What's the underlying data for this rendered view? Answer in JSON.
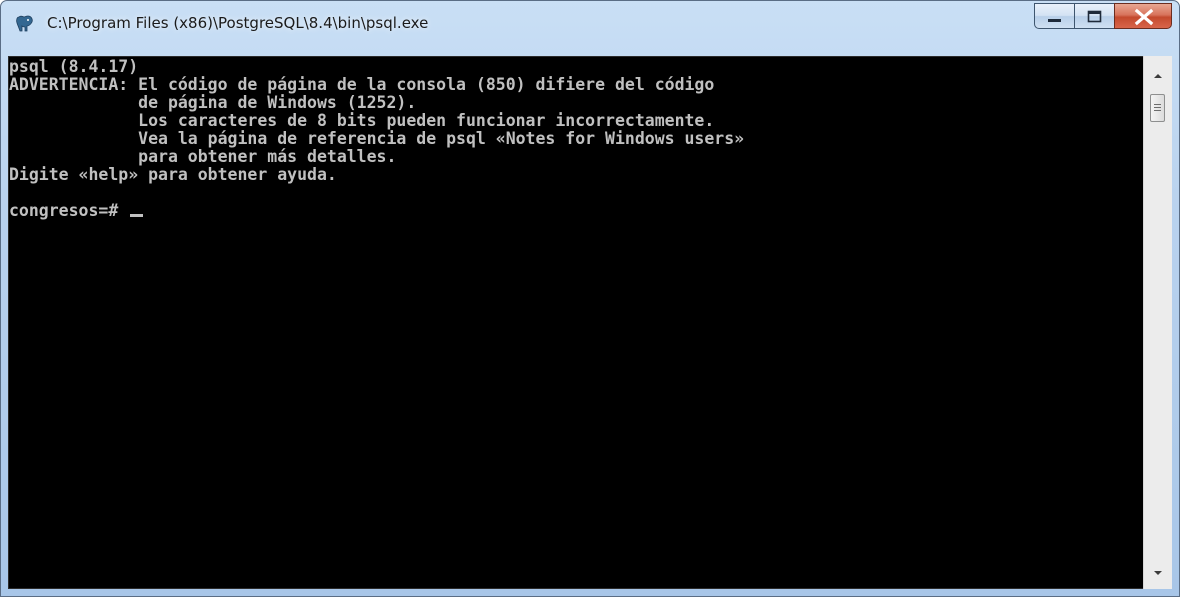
{
  "window": {
    "title": "C:\\Program Files (x86)\\PostgreSQL\\8.4\\bin\\psql.exe"
  },
  "console": {
    "lines": [
      "psql (8.4.17)",
      "ADVERTENCIA: El código de página de la consola (850) difiere del código",
      "             de página de Windows (1252).",
      "             Los caracteres de 8 bits pueden funcionar incorrectamente.",
      "             Vea la página de referencia de psql «Notes for Windows users»",
      "             para obtener más detalles.",
      "Digite «help» para obtener ayuda.",
      "",
      "congresos=# "
    ]
  },
  "colors": {
    "console_background": "#000000",
    "console_text": "#c0c0c0",
    "close_button": "#c44a2e",
    "title_bar": "#b9d2ee"
  },
  "icons": {
    "app": "postgresql-elephant-icon",
    "minimize": "minimize-icon",
    "maximize": "maximize-icon",
    "close": "close-icon",
    "scroll_up": "scroll-up-arrow-icon",
    "scroll_down": "scroll-down-arrow-icon"
  }
}
